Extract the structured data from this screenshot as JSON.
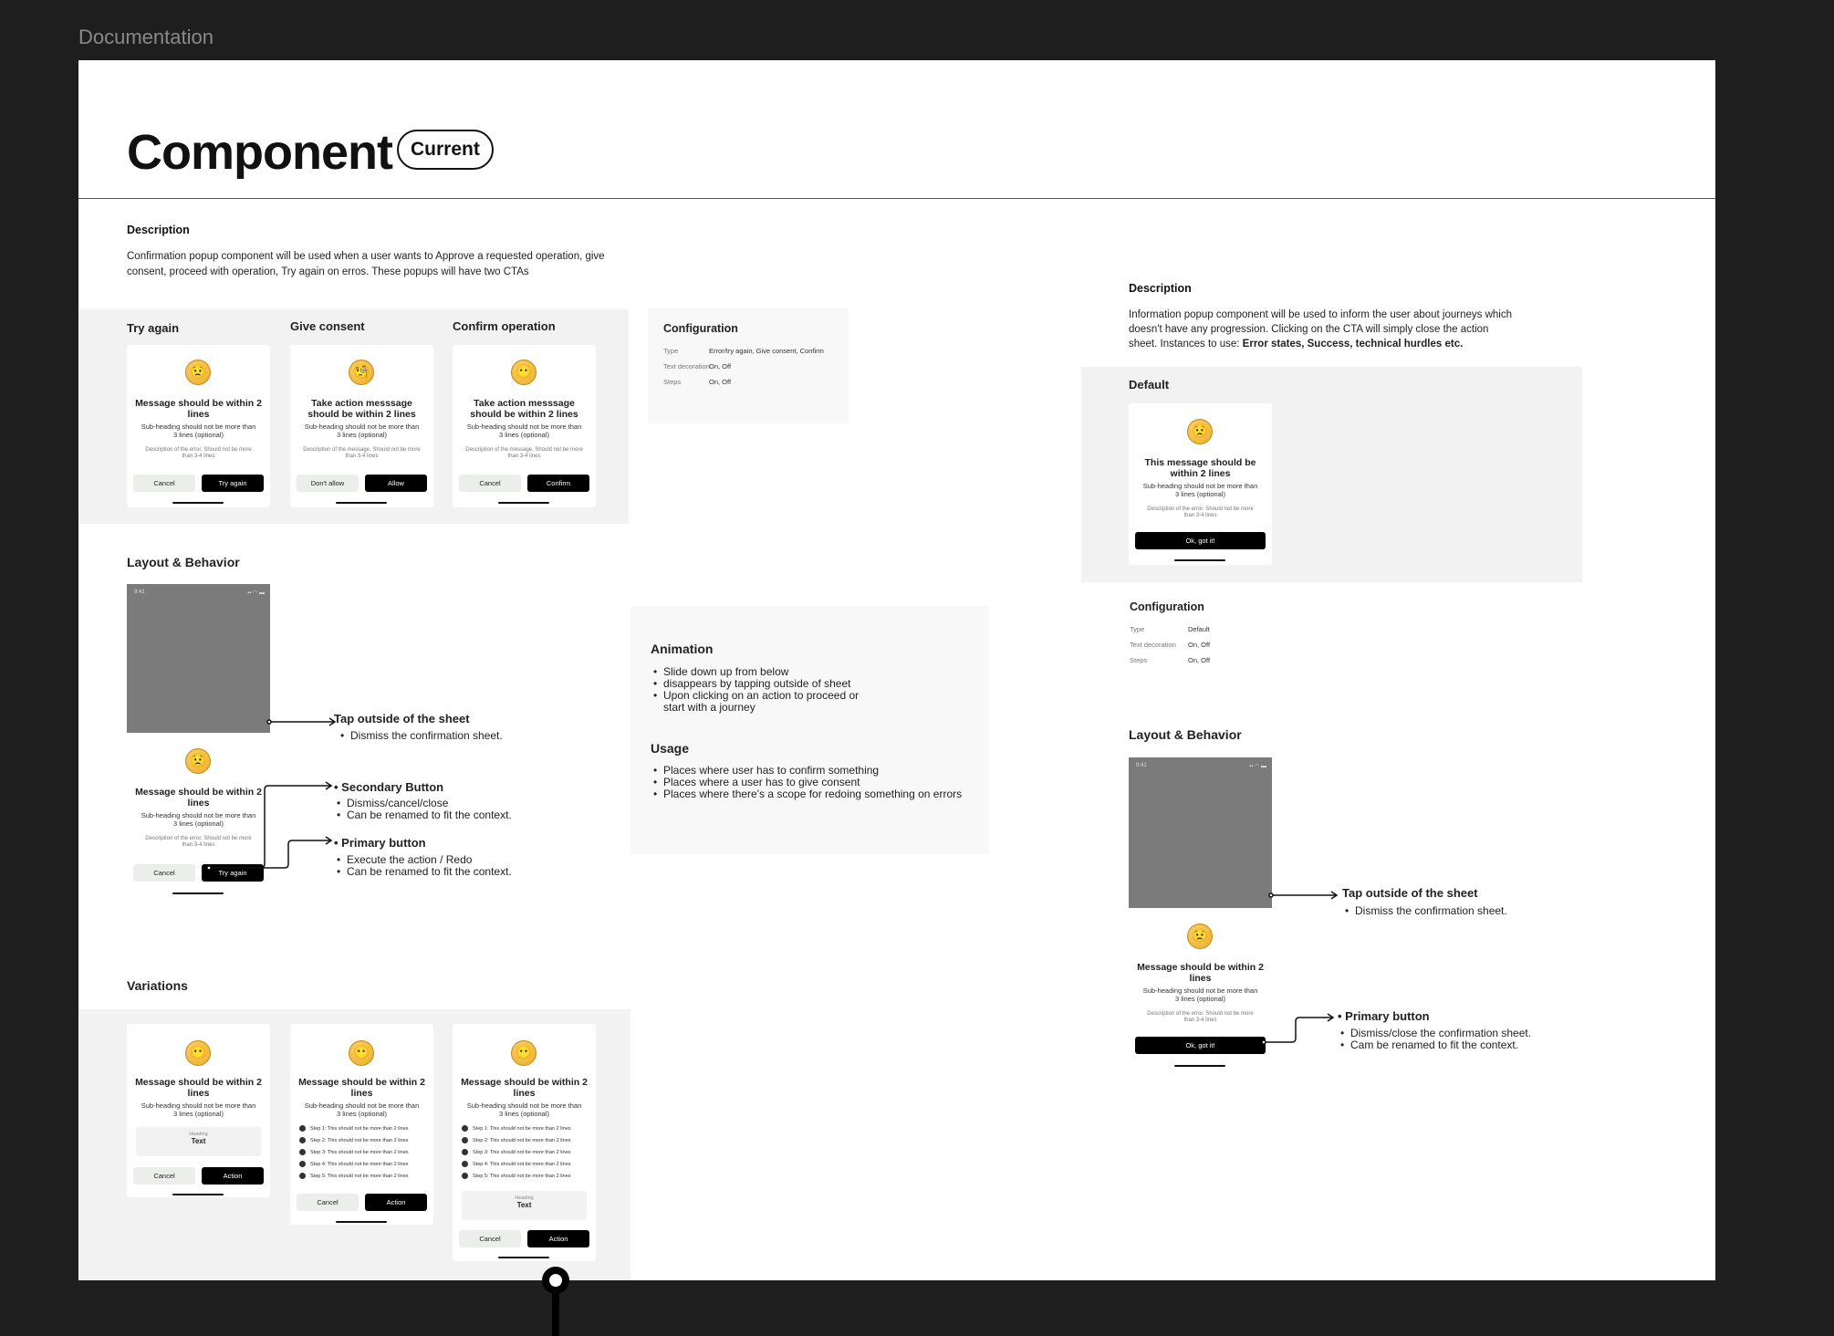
{
  "header": {
    "section_label": "Documentation",
    "title": "Component",
    "badge": "Current"
  },
  "confirmation": {
    "description_heading": "Description",
    "description": "Confirmation popup component will be used when a user wants to Approve a requested operation, give consent, proceed with operation, Try again  on erros. These popups will have two CTAs",
    "cards": [
      {
        "label": "Try again",
        "emoji": "😟",
        "title": "Message should be within 2 lines",
        "subheading": "Sub-heading should not be more than 3 lines (optional)",
        "desc": "Description of the error. Should not be more than 3-4 lines",
        "secondary": "Cancel",
        "primary": "Try again"
      },
      {
        "label": "Give consent",
        "emoji": "🧐",
        "title": "Take action messsage should be within 2 lines",
        "subheading": "Sub-heading should not be more than 3 lines (optional)",
        "desc": "Description of the message. Should not be more than 3-4 lines",
        "secondary": "Don't allow",
        "primary": "Allow"
      },
      {
        "label": "Confirm operation",
        "emoji": "😶",
        "title": "Take action messsage should be within 2 lines",
        "subheading": "Sub-heading should not be more than 3 lines (optional)",
        "desc": "Description of the message. Should not be more than 3-4 lines",
        "secondary": "Cancel",
        "primary": "Confirm"
      }
    ],
    "configuration": {
      "heading": "Configuration",
      "rows": [
        {
          "key": "Type",
          "value": "Error/try again, Give consent, Confirm"
        },
        {
          "key": "Text decoration",
          "value": "On, Off"
        },
        {
          "key": "Steps",
          "value": "On, Off"
        }
      ]
    },
    "layout": {
      "heading": "Layout & Behavior",
      "time": "9:41",
      "status_icons": "▪▪ ◠ ▬",
      "emoji": "😟",
      "title": "Message should be within 2 lines",
      "subheading": "Sub-heading should not be more than 3 lines (optional)",
      "desc": "Description of the error. Should not be more than 3-4 lines",
      "secondary": "Cancel",
      "primary": "Try again",
      "ann_tap_title": "Tap outside of the sheet",
      "ann_tap_items": [
        "Dismiss the confirmation sheet."
      ],
      "ann_secondary_title": "Secondary Button",
      "ann_secondary_items": [
        "Dismiss/cancel/close",
        "Can be renamed to fit the context."
      ],
      "ann_primary_title": "Primary button",
      "ann_primary_items": [
        "Execute the action / Redo",
        "Can be renamed to fit the context."
      ]
    },
    "animation": {
      "heading": "Animation",
      "items": [
        "Slide down up from below",
        "disappears by tapping outside of sheet",
        "Upon clicking on an action to proceed or start with a journey"
      ]
    },
    "usage": {
      "heading": "Usage",
      "items": [
        "Places where user has to confirm something",
        "Places where  a user has to give consent",
        "Places where there's a scope for redoing something on errors"
      ]
    },
    "variations": {
      "heading": "Variations",
      "emoji": "😶",
      "title": "Message should be within 2 lines",
      "subheading": "Sub-heading should not be more than 3 lines (optional)",
      "field_label": "Heading",
      "field_value": "Text",
      "secondary": "Cancel",
      "primary": "Action",
      "steps": [
        "Step 1: This should not be more than 2 lines",
        "Step 2: This should not be more than 2 lines",
        "Step 3: This should not be more than 2 lines",
        "Step 4: This should not be more than 2 lines",
        "Step 5: This should not be more than 2 lines"
      ]
    }
  },
  "information": {
    "description_heading": "Description",
    "description_plain": "Information popup component will be used to inform the user about  journeys which doesn't have any progression. Clicking on the CTA will simply close the action sheet. Instances to use: ",
    "description_bold": "Error states, Success, technical hurdles etc.",
    "default": {
      "label": "Default",
      "emoji": "😟",
      "title": "This  message should be within 2 lines",
      "subheading": "Sub-heading should not be more than 3 lines (optional)",
      "desc": "Description of the error. Should not be more than 3-4 lines",
      "primary": "Ok, got it!"
    },
    "configuration": {
      "heading": "Configuration",
      "rows": [
        {
          "key": "Type",
          "value": "Default"
        },
        {
          "key": "Text decoration",
          "value": "On, Off"
        },
        {
          "key": "Steps",
          "value": "On, Off"
        }
      ]
    },
    "layout": {
      "heading": "Layout & Behavior",
      "time": "9:41",
      "status_icons": "▪▪ ◠ ▬",
      "emoji": "😟",
      "title": "Message should be within 2 lines",
      "subheading": "Sub-heading should not be more than 3 lines (optional)",
      "desc": "Description of the error. Should not be more than 3-4 lines",
      "primary": "Ok, got it!",
      "ann_tap_title": "Tap outside of the sheet",
      "ann_tap_items": [
        "Dismiss the confirmation sheet."
      ],
      "ann_primary_title": "Primary button",
      "ann_primary_items": [
        "Dismiss/close the confirmation sheet.",
        "Cam be renamed to fit the context."
      ]
    }
  }
}
